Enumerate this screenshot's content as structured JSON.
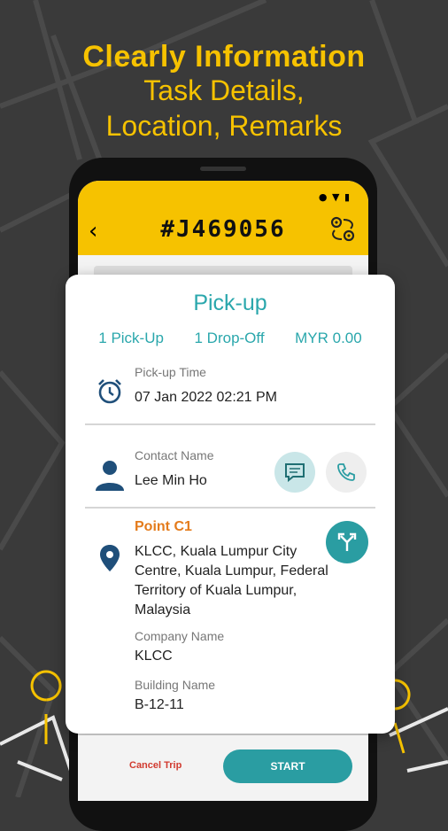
{
  "promo": {
    "headline": "Clearly Information",
    "line2": "Task Details,",
    "line3": "Location, Remarks"
  },
  "appbar": {
    "job_id": "#J469056",
    "back_icon": "back-arrow-icon",
    "route_icon": "route-swap-icon"
  },
  "card": {
    "title": "Pick-up",
    "summary": {
      "pickups": "1 Pick-Up",
      "dropoffs": "1 Drop-Off",
      "amount": "MYR 0.00"
    },
    "pickup_time": {
      "label": "Pick-up Time",
      "value": "07 Jan 2022 02:21 PM"
    },
    "contact": {
      "label": "Contact Name",
      "value": "Lee Min Ho"
    },
    "point": {
      "label": "Point C1",
      "address": "KLCC, Kuala Lumpur City Centre, Kuala Lumpur, Federal Territory of Kuala Lumpur, Malaysia"
    },
    "company": {
      "label": "Company Name",
      "value": "KLCC"
    },
    "building": {
      "label": "Building Name",
      "value": "B-12-11"
    }
  },
  "actions": {
    "cancel": "Cancel Trip",
    "start": "START"
  },
  "colors": {
    "accent_yellow": "#f6c200",
    "teal": "#2aa7ac",
    "orange": "#e47b1b",
    "cancel_red": "#d13a2f"
  }
}
